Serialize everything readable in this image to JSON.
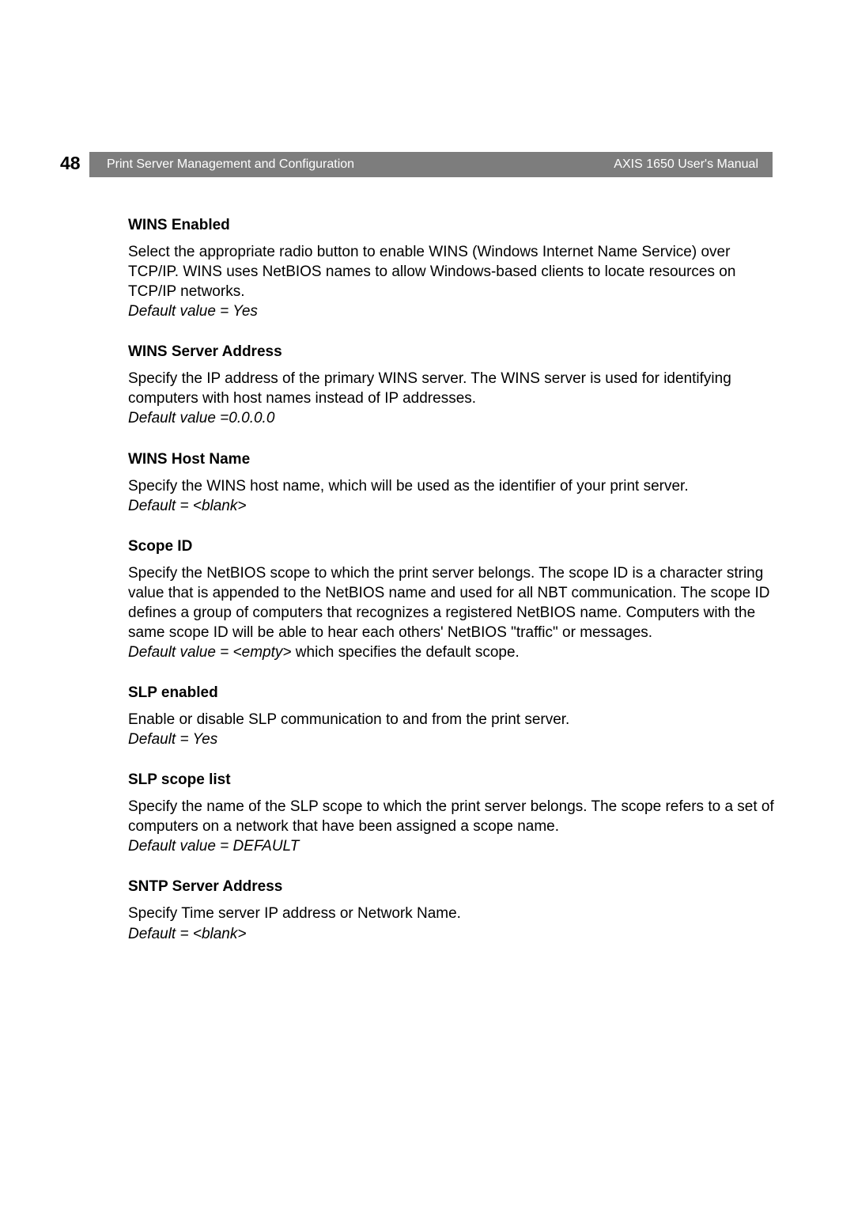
{
  "page_number": "48",
  "header": {
    "left": "Print Server Management and Configuration",
    "right": "AXIS 1650 User's Manual"
  },
  "sections": [
    {
      "title": "WINS Enabled",
      "body": "Select the appropriate radio button to enable WINS (Windows Internet Name Service) over TCP/IP. WINS uses NetBIOS names to allow Windows-based clients to locate resources on TCP/IP networks.",
      "default": "Default value = Yes"
    },
    {
      "title": "WINS Server Address",
      "body": "Specify the IP address of the primary WINS server. The WINS server is used for identifying computers with host names instead of IP addresses.",
      "default": "Default value =0.0.0.0"
    },
    {
      "title": "WINS Host Name",
      "body": "Specify the WINS host name, which will be used as the identifier of your print server.",
      "default": "Default = <blank>"
    },
    {
      "title": "Scope ID",
      "body": "Specify the NetBIOS scope to which the print server belongs. The scope ID is a character string value that is appended to the NetBIOS name and used for all NBT communication. The scope ID defines a group of computers that recognizes a registered NetBIOS name. Computers with the same scope ID will be able to hear each others' NetBIOS \"traffic\" or messages.",
      "default_prefix": "Default value = <empty>",
      "default_suffix": " which specifies the default scope."
    },
    {
      "title": "SLP enabled",
      "body": "Enable or disable SLP communication to and from the print server.",
      "default": "Default = Yes"
    },
    {
      "title": "SLP scope list",
      "body": "Specify the name of the SLP scope to which the print server belongs. The scope refers to a set of computers on a network that have been assigned a scope name.",
      "default": "Default value = DEFAULT"
    },
    {
      "title": "SNTP Server Address",
      "body": "Specify Time server IP address or Network Name.",
      "default": "Default = <blank>"
    }
  ]
}
